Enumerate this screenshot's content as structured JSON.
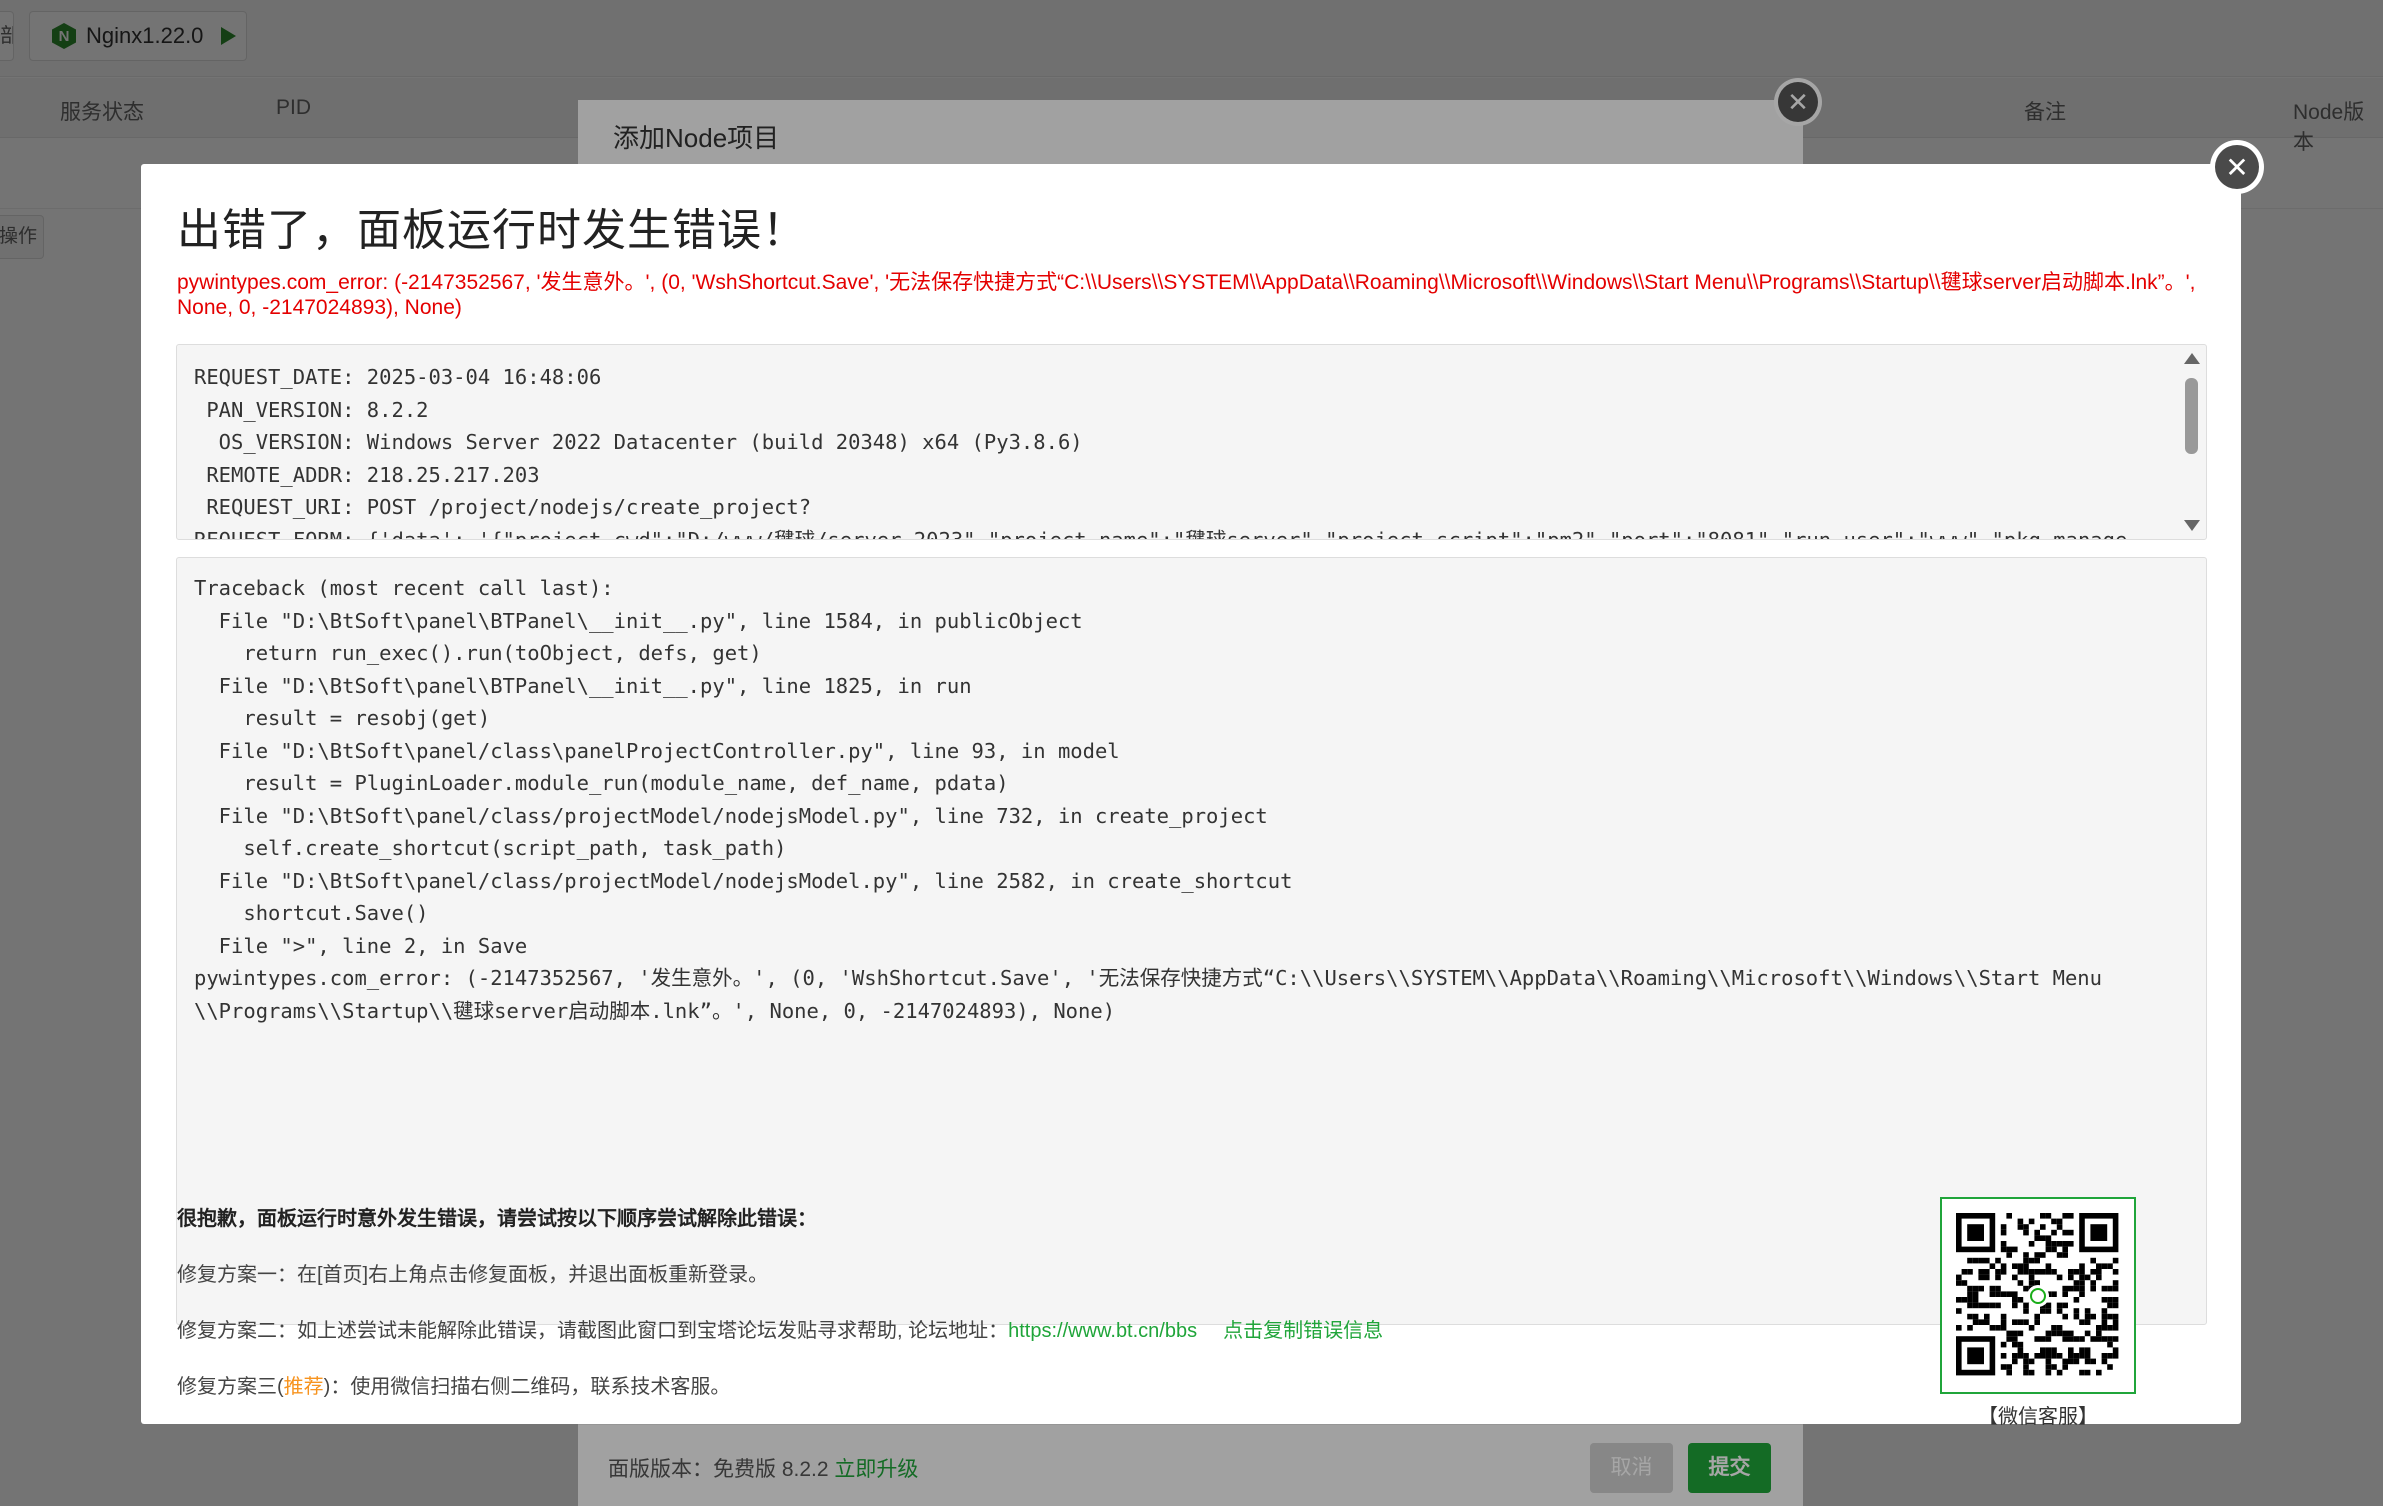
{
  "background": {
    "stub_left_button": "部",
    "server_button_label": "Nginx1.22.0",
    "server_logo_letter": "N",
    "play_icon": "play-icon",
    "table_headers": {
      "status": "服务状态",
      "pid": "PID",
      "remark": "备注",
      "node_version": "Node版本"
    },
    "operation_stub": "操作"
  },
  "node_modal": {
    "title": "添加Node项目",
    "version_label": "面版版本：免费版 8.2.2",
    "upgrade_link": "立即升级",
    "cancel_button": "取消",
    "submit_button": "提交"
  },
  "error_modal": {
    "title": "出错了，面板运行时发生错误！",
    "error_message": "pywintypes.com_error: (-2147352567, '发生意外。', (0, 'WshShortcut.Save', '无法保存快捷方式“C:\\\\Users\\\\SYSTEM\\\\AppData\\\\Roaming\\\\Microsoft\\\\Windows\\\\Start Menu\\\\Programs\\\\Startup\\\\毽球server启动脚本.lnk”。', None, 0, -2147024893), None)",
    "request_info": "REQUEST_DATE: 2025-03-04 16:48:06\n PAN_VERSION: 8.2.2\n  OS_VERSION: Windows Server 2022 Datacenter (build 20348) x64 (Py3.8.6)\n REMOTE_ADDR: 218.25.217.203\n REQUEST_URI: POST /project/nodejs/create_project?\nREQUEST_FORM: {'data': '{\"project_cwd\":\"D:/www/毽球/server-2023\",\"project_name\":\"毽球server\",\"project_script\":\"pm2\",\"port\":\"8081\",\"run_user\":\"www\",\"pkg_manage",
    "traceback": "Traceback (most recent call last):\n  File \"D:\\BtSoft\\panel\\BTPanel\\__init__.py\", line 1584, in publicObject\n    return run_exec().run(toObject, defs, get)\n  File \"D:\\BtSoft\\panel\\BTPanel\\__init__.py\", line 1825, in run\n    result = resobj(get)\n  File \"D:\\BtSoft\\panel/class\\panelProjectController.py\", line 93, in model\n    result = PluginLoader.module_run(module_name, def_name, pdata)\n  File \"D:\\BtSoft\\panel/class/projectModel/nodejsModel.py\", line 732, in create_project\n    self.create_shortcut(script_path, task_path)\n  File \"D:\\BtSoft\\panel/class/projectModel/nodejsModel.py\", line 2582, in create_shortcut\n    shortcut.Save()\n  File \">\", line 2, in Save\npywintypes.com_error: (-2147352567, '发生意外。', (0, 'WshShortcut.Save', '无法保存快捷方式“C:\\\\Users\\\\SYSTEM\\\\AppData\\\\Roaming\\\\Microsoft\\\\Windows\\\\Start Menu\n\\\\Programs\\\\Startup\\\\毽球server启动脚本.lnk”。', None, 0, -2147024893), None)",
    "help_heading": "很抱歉，面板运行时意外发生错误，请尝试按以下顺序尝试解除此错误：",
    "fix1": "修复方案一：在[首页]右上角点击修复面板，并退出面板重新登录。",
    "fix2_prefix": "修复方案二：如上述尝试未能解除此错误，请截图此窗口到宝塔论坛发贴寻求帮助, 论坛地址：",
    "fix2_link": "https://www.bt.cn/bbs",
    "fix2_copy": "点击复制错误信息",
    "fix3_prefix": "修复方案三(",
    "fix3_recommend": "推荐",
    "fix3_suffix": ")：使用微信扫描右侧二维码，联系技术客服。",
    "qr_label": "【微信客服】"
  },
  "colors": {
    "accent_green": "#20a53a",
    "error_red": "#e40000",
    "recommend_orange": "#f7931e"
  }
}
